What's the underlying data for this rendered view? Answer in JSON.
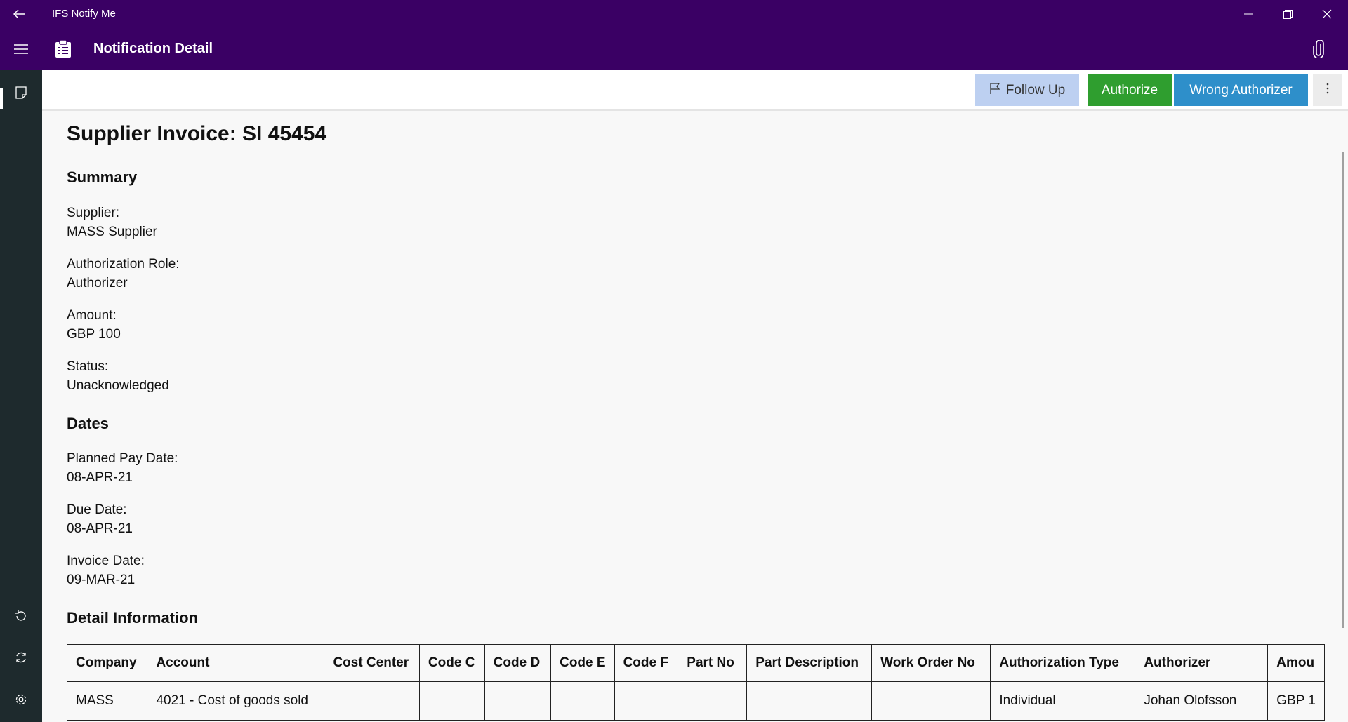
{
  "window": {
    "app_title": "IFS Notify Me"
  },
  "header": {
    "page_title": "Notification Detail"
  },
  "toolbar": {
    "follow_up_label": "Follow Up",
    "authorize_label": "Authorize",
    "wrong_authorizer_label": "Wrong Authorizer"
  },
  "document": {
    "title": "Supplier Invoice: SI 45454",
    "summary_heading": "Summary",
    "summary": [
      {
        "label": "Supplier:",
        "value": "MASS Supplier"
      },
      {
        "label": "Authorization Role:",
        "value": "Authorizer"
      },
      {
        "label": "Amount:",
        "value": "GBP 100"
      },
      {
        "label": "Status:",
        "value": "Unacknowledged"
      }
    ],
    "dates_heading": "Dates",
    "dates": [
      {
        "label": "Planned Pay Date:",
        "value": "08-APR-21"
      },
      {
        "label": "Due Date:",
        "value": "08-APR-21"
      },
      {
        "label": "Invoice Date:",
        "value": "09-MAR-21"
      }
    ],
    "detail_heading": "Detail Information"
  },
  "detail_table": {
    "columns": [
      "Company",
      "Account",
      "Cost Center",
      "Code C",
      "Code D",
      "Code E",
      "Code F",
      "Part No",
      "Part Description",
      "Work Order No",
      "Authorization Type",
      "Authorizer",
      "Amou"
    ],
    "rows": [
      [
        "MASS",
        "4021 - Cost of goods sold",
        "",
        "",
        "",
        "",
        "",
        "",
        "",
        "",
        "Individual",
        "Johan Olofsson",
        "GBP 1"
      ]
    ]
  },
  "colors": {
    "title_bar": "#3a0064",
    "rail": "#1e2a2d",
    "follow_up": "#bdd0f1",
    "authorize": "#2f9e2f",
    "wrong_authorizer": "#2e8fca"
  }
}
